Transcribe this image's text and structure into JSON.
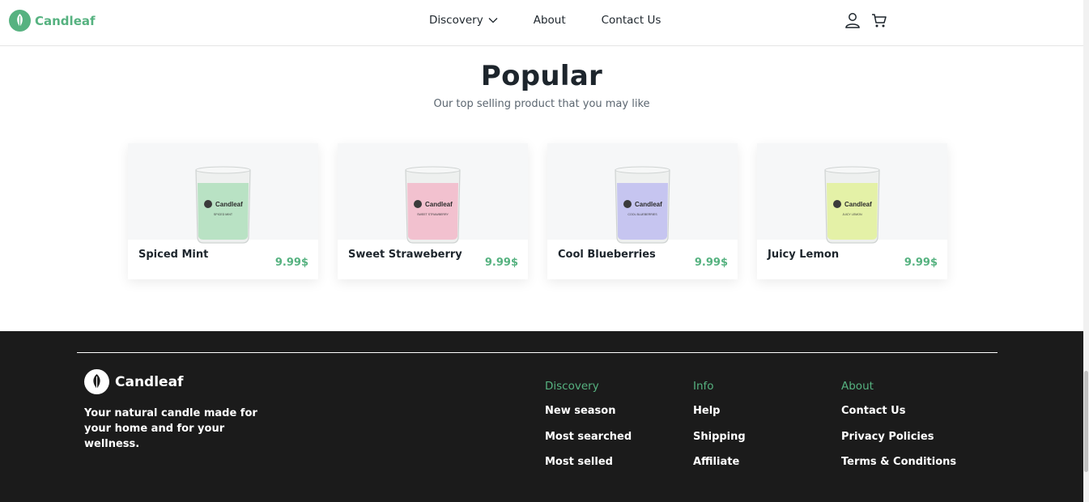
{
  "header": {
    "brand": "Candleaf",
    "nav": [
      {
        "label": "Discovery"
      },
      {
        "label": "About"
      },
      {
        "label": "Contact Us"
      }
    ],
    "icons": [
      "user-icon",
      "cart-icon"
    ]
  },
  "popular": {
    "title": "Popular",
    "subtitle": "Our top selling product that you may like",
    "products": [
      {
        "name": "Spiced Mint",
        "price": "9.99$",
        "color": "#b9e2c4",
        "label": "SPICED MINT"
      },
      {
        "name": "Sweet Straweberry",
        "price": "9.99$",
        "color": "#f2c1cf",
        "label": "SWEET STRAWBERRY"
      },
      {
        "name": "Cool Blueberries",
        "price": "9.99$",
        "color": "#c6c5f0",
        "label": "COOL BLUEBERRIES"
      },
      {
        "name": "Juicy Lemon",
        "price": "9.99$",
        "color": "#e4f1a7",
        "label": "JUICY LEMON"
      }
    ]
  },
  "footer": {
    "brand": "Candleaf",
    "tagline": "Your natural candle made for your home and for your wellness.",
    "columns": [
      {
        "title": "Discovery",
        "links": [
          "New season",
          "Most searched",
          "Most selled"
        ]
      },
      {
        "title": "Info",
        "links": [
          "Help",
          "Shipping",
          "Affiliate"
        ]
      },
      {
        "title": "About",
        "links": [
          "Contact Us",
          "Privacy Policies",
          "Terms & Conditions"
        ]
      }
    ]
  },
  "colors": {
    "accent": "#56b280",
    "footer_bg": "#1b1b1b",
    "text": "#1d252c"
  }
}
